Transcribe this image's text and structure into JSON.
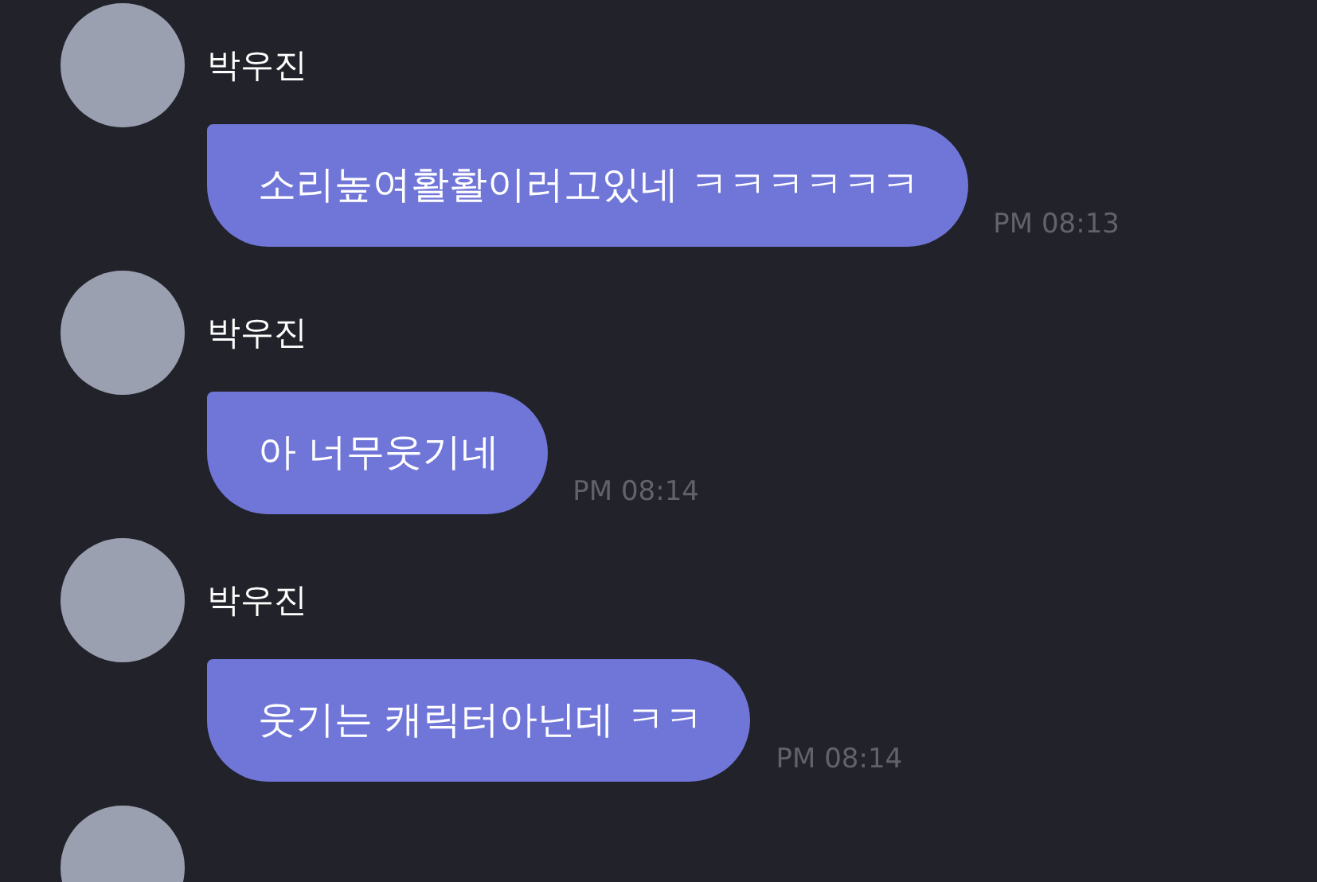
{
  "messages": [
    {
      "sender": "박우진",
      "text": "소리높여활활이러고있네 ㅋㅋㅋㅋㅋㅋ",
      "time": "PM 08:13"
    },
    {
      "sender": "박우진",
      "text": "아 너무웃기네",
      "time": "PM 08:14"
    },
    {
      "sender": "박우진",
      "text": "웃기는 캐릭터아닌데 ㅋㅋ",
      "time": "PM 08:14"
    }
  ],
  "next_message_partial": {
    "sender_avatar": true
  }
}
